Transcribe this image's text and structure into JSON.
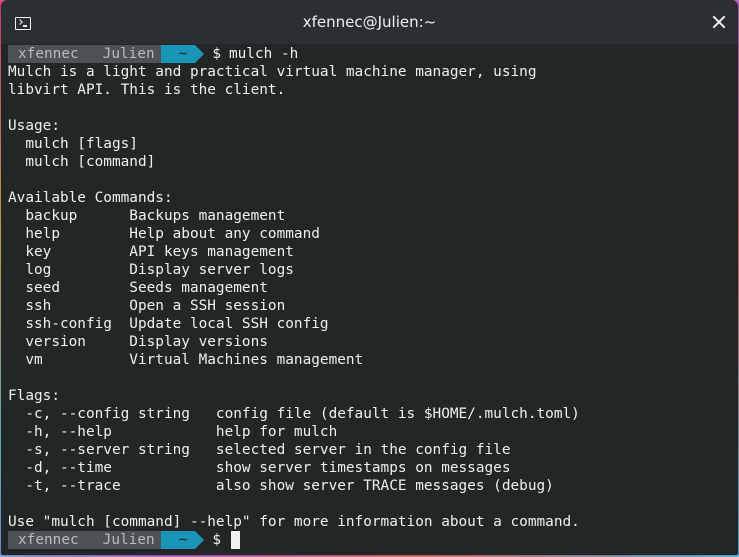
{
  "window": {
    "title": "xfennec@Julien:~"
  },
  "prompt": {
    "user": "xfennec",
    "host": "Julien",
    "dir": "~",
    "symbol": "$"
  },
  "command": "mulch -h",
  "output": [
    "Mulch is a light and practical virtual machine manager, using",
    "libvirt API. This is the client.",
    "",
    "Usage:",
    "  mulch [flags]",
    "  mulch [command]",
    "",
    "Available Commands:",
    "  backup      Backups management",
    "  help        Help about any command",
    "  key         API keys management",
    "  log         Display server logs",
    "  seed        Seeds management",
    "  ssh         Open a SSH session",
    "  ssh-config  Update local SSH config",
    "  version     Display versions",
    "  vm          Virtual Machines management",
    "",
    "Flags:",
    "  -c, --config string   config file (default is $HOME/.mulch.toml)",
    "  -h, --help            help for mulch",
    "  -s, --server string   selected server in the config file",
    "  -d, --time            show server timestamps on messages",
    "  -t, --trace           also show server TRACE messages (debug)",
    "",
    "Use \"mulch [command] --help\" for more information about a command."
  ],
  "icons": {
    "window": "terminal-icon",
    "close": "close-icon"
  }
}
